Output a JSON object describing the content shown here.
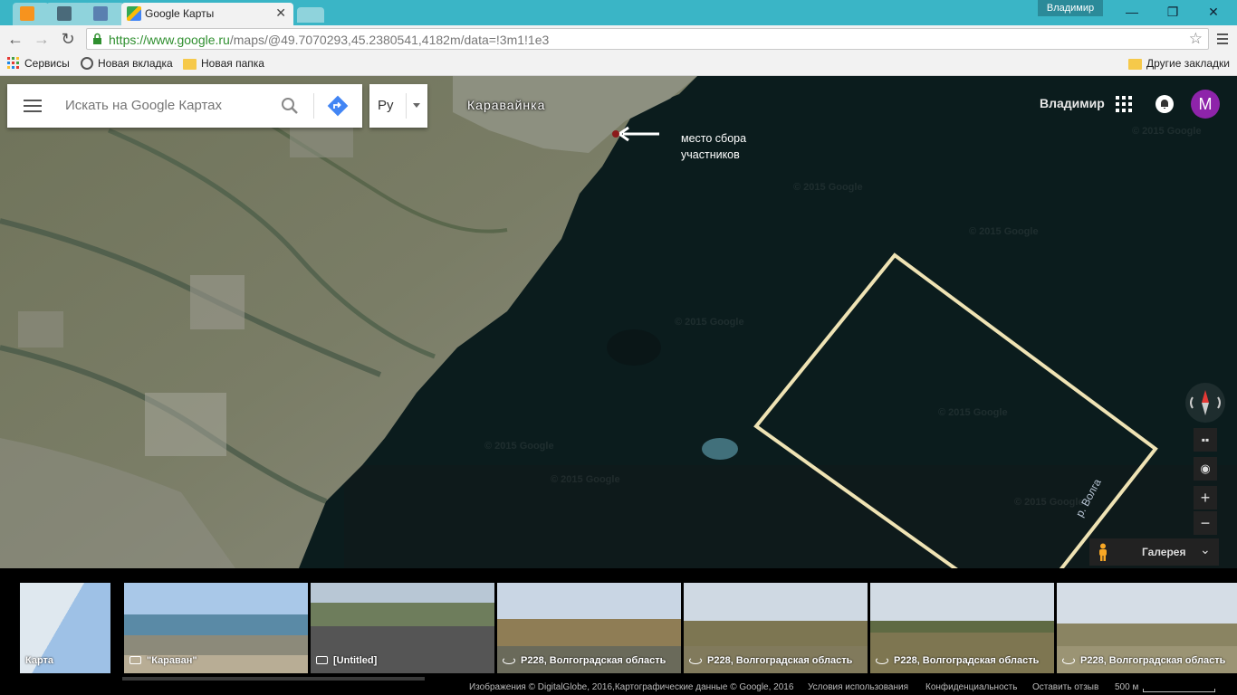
{
  "browser": {
    "tabs": [
      {
        "title": ""
      },
      {
        "title": ""
      },
      {
        "title": ""
      },
      {
        "title": "Google Карты"
      }
    ],
    "user_chip": "Владимир",
    "url_host": "https://www.google.ru",
    "url_rest": "/maps/@49.7070293,45.2380541,4182m/data=!3m1!1e3",
    "bookmarks": [
      {
        "label": "Сервисы",
        "icon": "apps-grid-icon"
      },
      {
        "label": "Новая вкладка",
        "icon": "history-icon"
      },
      {
        "label": "Новая папка",
        "icon": "folder-icon"
      }
    ],
    "other_bookmarks": "Другие закладки"
  },
  "maps": {
    "search_placeholder": "Искать на Google Картах",
    "language": "Ру",
    "account_name": "Владимир",
    "avatar_letter": "M",
    "place_label": "Каравайнка",
    "annotation_line1": "место сбора",
    "annotation_line2": "участников",
    "river_label": "р. Волга",
    "watermark": "© 2015 Google",
    "gallery_label": "Галерея",
    "zoom_in": "+",
    "zoom_out": "−"
  },
  "filmstrip": [
    {
      "caption": "Карта",
      "kind": "map"
    },
    {
      "caption": "\"Караван\"",
      "kind": "photo"
    },
    {
      "caption": "[Untitled]",
      "kind": "photo"
    },
    {
      "caption": "Р228, Волгоградская область",
      "kind": "streetview"
    },
    {
      "caption": "Р228, Волгоградская область",
      "kind": "streetview"
    },
    {
      "caption": "Р228, Волгоградская область",
      "kind": "streetview"
    },
    {
      "caption": "Р228, Волгоградская область",
      "kind": "streetview"
    }
  ],
  "status": {
    "attribution": "Изображения © DigitalGlobe, 2016,Картографические данные © Google, 2016",
    "terms": "Условия использования",
    "privacy": "Конфиденциальность",
    "feedback": "Оставить отзыв",
    "scale": "500 м"
  },
  "colors": {
    "titlebar": "#3ab5c6",
    "water": "#0b1c1d",
    "land": "#6b6e58",
    "annotation_box": "#efe3b4",
    "avatar": "#8e24aa",
    "url_secure": "#2f8f2f"
  }
}
